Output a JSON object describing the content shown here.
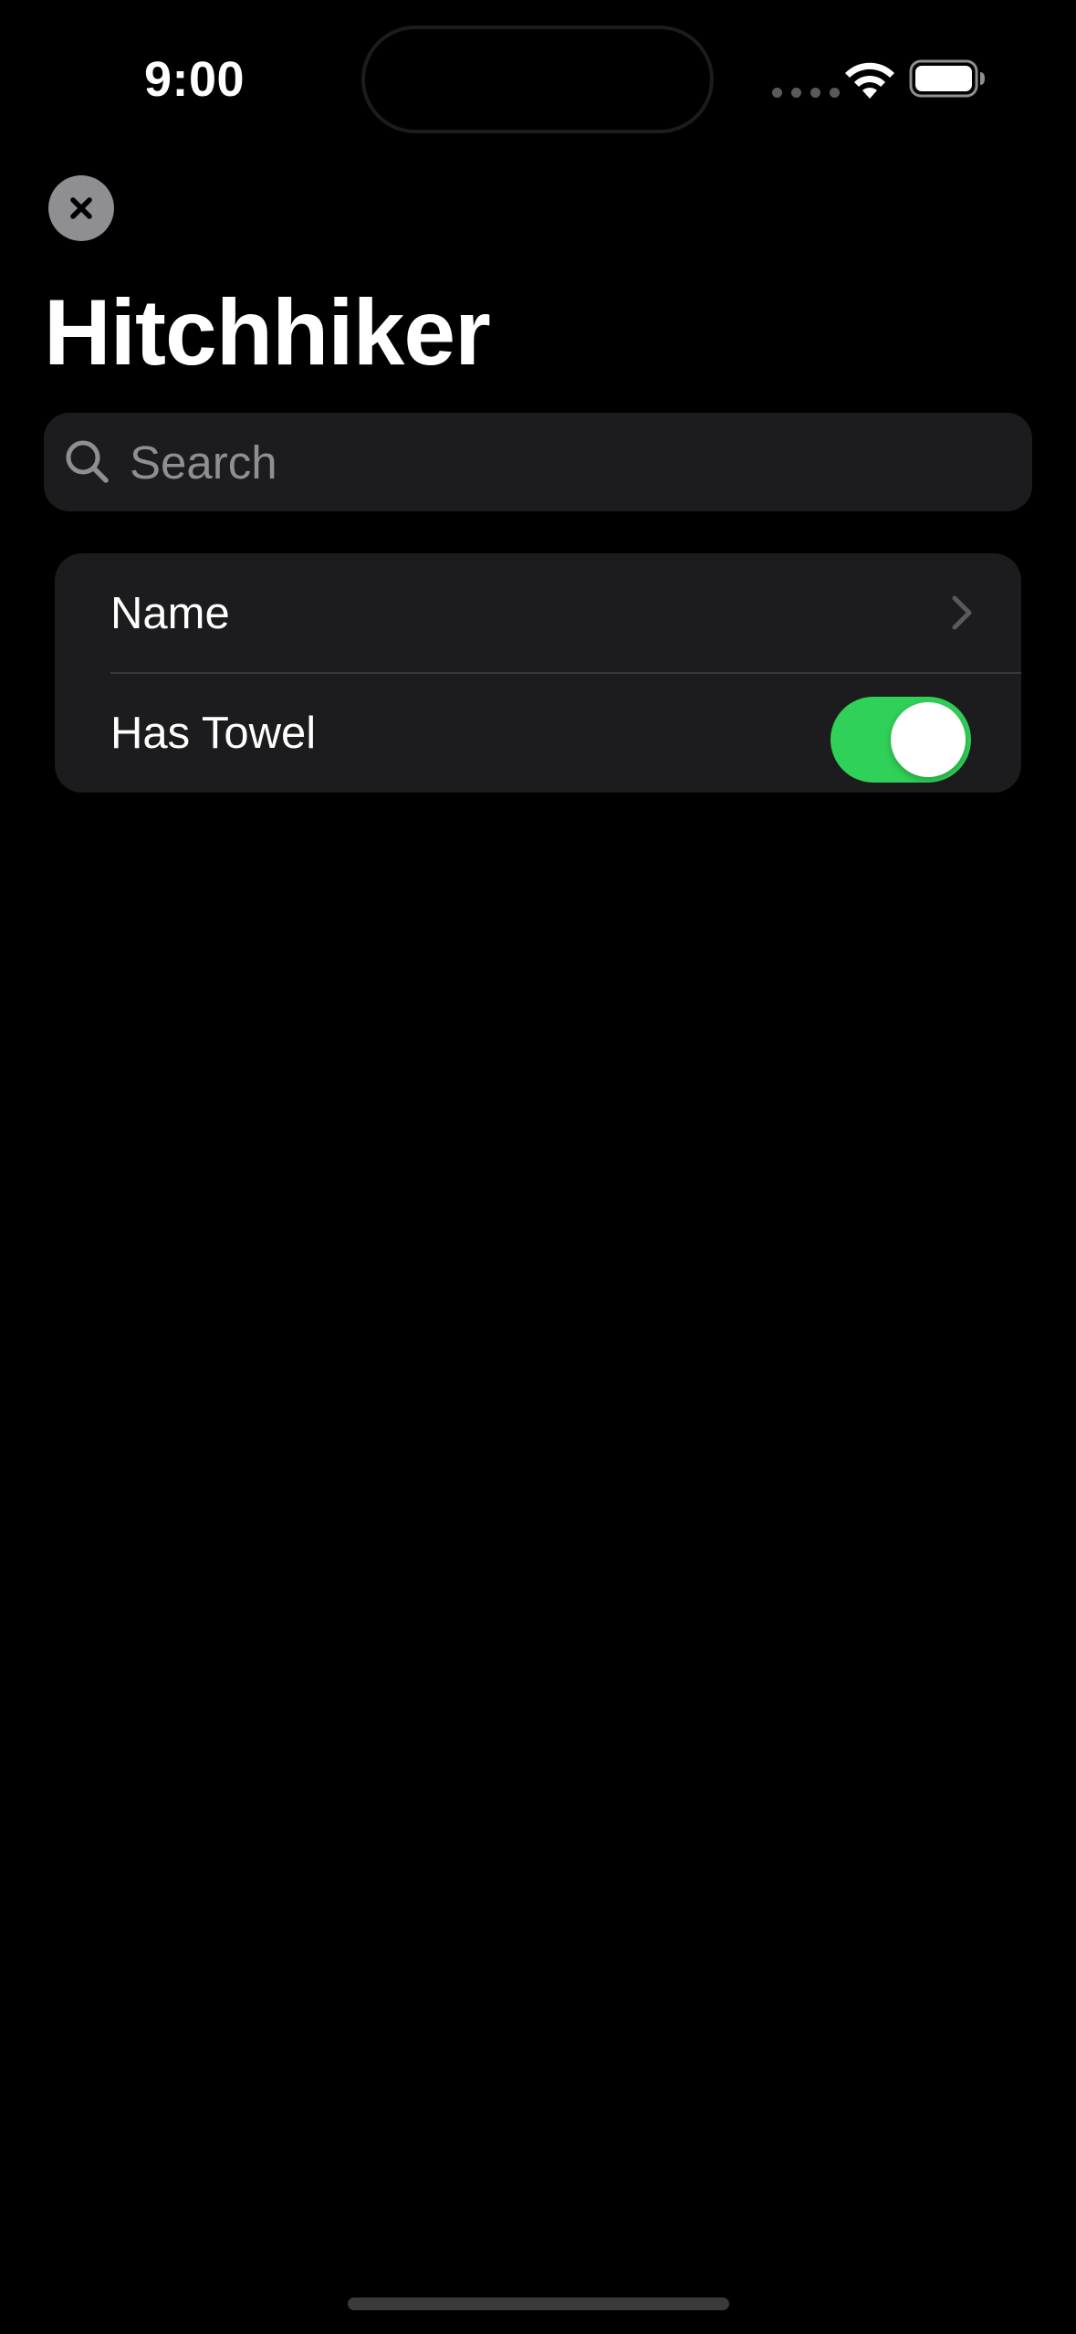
{
  "status_bar": {
    "time": "9:00",
    "icons": [
      "cellular-signal-icon",
      "wifi-icon",
      "battery-icon"
    ]
  },
  "toolbar": {
    "close_icon": "close-icon"
  },
  "page": {
    "title": "Hitchhiker"
  },
  "search": {
    "placeholder": "Search",
    "value": "",
    "icon": "search-icon"
  },
  "form": {
    "rows": [
      {
        "label": "Name",
        "accessory": "chevron-right-icon"
      },
      {
        "label": "Has Towel",
        "accessory": "toggle",
        "toggle_on": true
      }
    ]
  },
  "colors": {
    "background": "#000000",
    "grouped_background": "#1c1c1e",
    "toggle_on": "#30d158",
    "secondary_text": "#8e8e93",
    "separator": "#38383a"
  }
}
